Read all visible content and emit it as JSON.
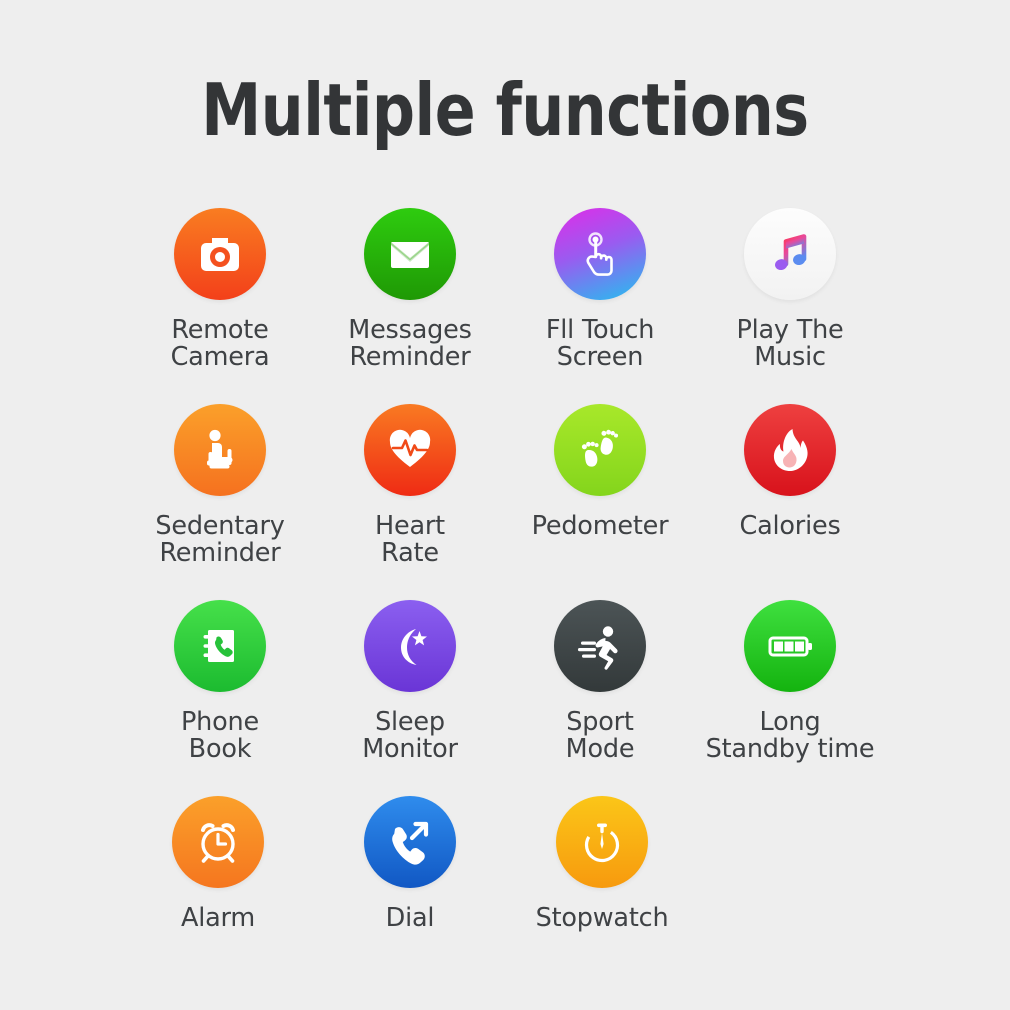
{
  "header": {
    "title": "Multiple functions"
  },
  "background_color": "#eeeeee",
  "label_color": "#3f4245",
  "title_color": "#333537",
  "features": {
    "rows": [
      [
        {
          "label": "Remote\nCamera",
          "icon": "camera-icon",
          "circle_colors": [
            "#f97d21",
            "#f3401a"
          ]
        },
        {
          "label": "Messages\nReminder",
          "icon": "envelope-icon",
          "circle_colors": [
            "#2ecc0f",
            "#1f9905"
          ]
        },
        {
          "label": "Fll Touch\nScreen",
          "icon": "touch-hand-icon",
          "circle_colors": [
            "#d939e8",
            "#22c1ef"
          ]
        },
        {
          "label": "Play The\nMusic",
          "icon": "music-note-icon",
          "circle_colors": [
            "#fcfcfc",
            "#f4f4f4"
          ]
        }
      ],
      [
        {
          "label": "Sedentary\nReminder",
          "icon": "sitting-person-icon",
          "circle_colors": [
            "#fba02a",
            "#f5711f"
          ]
        },
        {
          "label": "Heart\nRate",
          "icon": "heart-pulse-icon",
          "circle_colors": [
            "#f97a22",
            "#ef2b14"
          ]
        },
        {
          "label": "Pedometer",
          "icon": "footprints-icon",
          "circle_colors": [
            "#a8e82a",
            "#84d51c"
          ]
        },
        {
          "label": "Calories",
          "icon": "flame-icon",
          "circle_colors": [
            "#ee4040",
            "#d8121b"
          ]
        }
      ],
      [
        {
          "label": "Phone\nBook",
          "icon": "phone-book-icon",
          "circle_colors": [
            "#46e04a",
            "#1cbb30"
          ]
        },
        {
          "label": "Sleep\nMonitor",
          "icon": "moon-star-icon",
          "circle_colors": [
            "#8b5ff0",
            "#6a35d6"
          ]
        },
        {
          "label": "Sport\nMode",
          "icon": "running-person-icon",
          "circle_colors": [
            "#4c5456",
            "#33393a"
          ]
        },
        {
          "label": "Long\nStandby time",
          "icon": "battery-icon",
          "circle_colors": [
            "#3fe03f",
            "#14b30f"
          ]
        }
      ],
      [
        {
          "label": "Alarm",
          "icon": "alarm-clock-icon",
          "circle_colors": [
            "#fba02a",
            "#f5761f"
          ]
        },
        {
          "label": "Dial",
          "icon": "outgoing-call-icon",
          "circle_colors": [
            "#2f8ced",
            "#1158c4"
          ]
        },
        {
          "label": "Stopwatch",
          "icon": "stopwatch-icon",
          "circle_colors": [
            "#fbc618",
            "#f79a0e"
          ]
        }
      ]
    ]
  }
}
